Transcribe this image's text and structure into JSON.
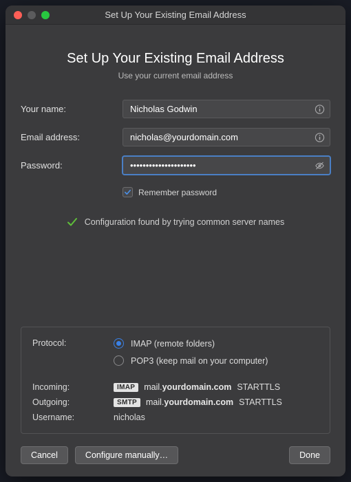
{
  "window": {
    "title": "Set Up Your Existing Email Address"
  },
  "hero": {
    "title": "Set Up Your Existing Email Address",
    "subtitle": "Use your current email address"
  },
  "form": {
    "name_label": "Your name:",
    "name_value": "Nicholas Godwin",
    "email_label": "Email address:",
    "email_value": "nicholas@yourdomain.com",
    "password_label": "Password:",
    "password_value": "•••••••••••••••••••••",
    "remember_label": "Remember password",
    "remember_checked": true
  },
  "status": {
    "message": "Configuration found by trying common server names"
  },
  "config": {
    "protocol_label": "Protocol:",
    "protocols": {
      "imap": {
        "label": "IMAP (remote folders)",
        "selected": true
      },
      "pop3": {
        "label": "POP3 (keep mail on your computer)",
        "selected": false
      }
    },
    "incoming_label": "Incoming:",
    "incoming_badge": "IMAP",
    "incoming_host_prefix": "mail.",
    "incoming_host_bold": "yourdomain.com",
    "incoming_security": "STARTTLS",
    "outgoing_label": "Outgoing:",
    "outgoing_badge": "SMTP",
    "outgoing_host_prefix": "mail.",
    "outgoing_host_bold": "yourdomain.com",
    "outgoing_security": "STARTTLS",
    "username_label": "Username:",
    "username_value": "nicholas"
  },
  "buttons": {
    "cancel": "Cancel",
    "configure": "Configure manually…",
    "done": "Done"
  }
}
